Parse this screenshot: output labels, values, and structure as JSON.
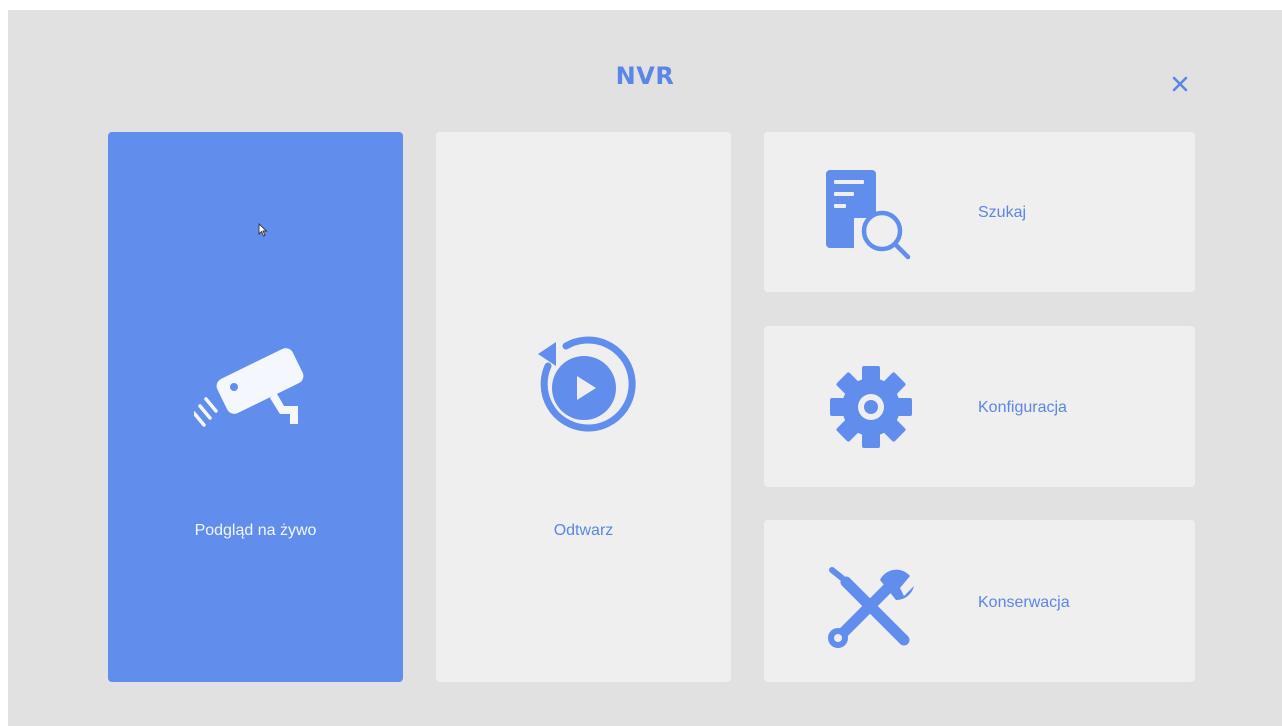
{
  "header": {
    "title": "NVR",
    "close_icon": "close-icon"
  },
  "colors": {
    "accent": "#618ded",
    "tile_bg": "#efefef",
    "screen_bg": "#e1e1e1",
    "text_accent": "#5b86e5"
  },
  "tiles": {
    "live": {
      "label": "Podgląd na żywo",
      "icon": "cctv-camera-icon",
      "selected": true
    },
    "playback": {
      "label": "Odtwarz",
      "icon": "replay-icon"
    },
    "search": {
      "label": "Szukaj",
      "icon": "document-search-icon"
    },
    "config": {
      "label": "Konfiguracja",
      "icon": "gear-icon"
    },
    "maintenance": {
      "label": "Konserwacja",
      "icon": "tools-icon"
    }
  }
}
